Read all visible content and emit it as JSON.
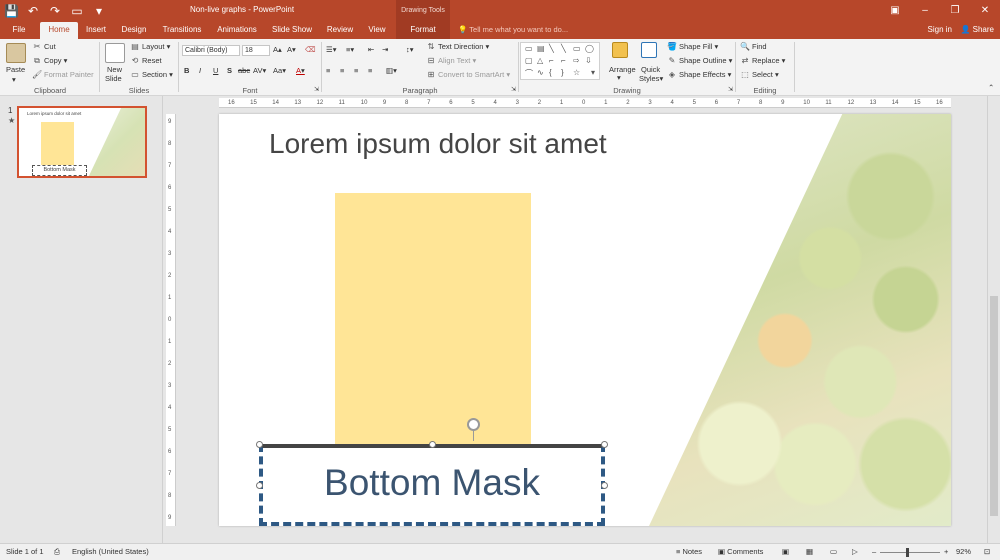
{
  "window": {
    "title": "Non-live graphs - PowerPoint",
    "context_group": "Drawing Tools",
    "quick_access": [
      "save-icon",
      "undo-icon",
      "redo-icon",
      "start-icon",
      "customize-icon"
    ]
  },
  "tabs": [
    {
      "label": "File"
    },
    {
      "label": "Home"
    },
    {
      "label": "Insert"
    },
    {
      "label": "Design"
    },
    {
      "label": "Transitions"
    },
    {
      "label": "Animations"
    },
    {
      "label": "Slide Show"
    },
    {
      "label": "Review"
    },
    {
      "label": "View"
    },
    {
      "label": "Format"
    }
  ],
  "tell_me": "Tell me what you want to do...",
  "account": {
    "sign_in": "Sign in",
    "share": "Share"
  },
  "ribbon": {
    "clipboard": {
      "label": "Clipboard",
      "paste": "Paste",
      "cut": "Cut",
      "copy": "Copy",
      "format_painter": "Format Painter"
    },
    "slides": {
      "label": "Slides",
      "new_slide": "New",
      "new_slide2": "Slide",
      "layout": "Layout",
      "reset": "Reset",
      "section": "Section"
    },
    "font": {
      "label": "Font",
      "font_name": "Calibri (Body)",
      "font_size": "18",
      "bold": "B",
      "italic": "I",
      "underline": "U",
      "strike": "S",
      "shadow": "abc",
      "spacing": "AV",
      "case": "Aa",
      "color": "A"
    },
    "paragraph": {
      "label": "Paragraph",
      "text_direction": "Text Direction",
      "align_text": "Align Text",
      "convert_smartart": "Convert to SmartArt"
    },
    "drawing": {
      "label": "Drawing",
      "arrange": "Arrange",
      "quick_styles": "Quick",
      "quick_styles2": "Styles",
      "shape_fill": "Shape Fill",
      "shape_outline": "Shape Outline",
      "shape_effects": "Shape Effects"
    },
    "editing": {
      "label": "Editing",
      "find": "Find",
      "replace": "Replace",
      "select": "Select"
    }
  },
  "thumbnail": {
    "number": "1",
    "title": "Lorem ipsum dolor sit amet",
    "box_text": "Bottom Mask"
  },
  "ruler": {
    "h_ticks": [
      "16",
      "15",
      "14",
      "13",
      "12",
      "11",
      "10",
      "9",
      "8",
      "7",
      "6",
      "5",
      "4",
      "3",
      "2",
      "1",
      "0",
      "1",
      "2",
      "3",
      "4",
      "5",
      "6",
      "7",
      "8",
      "9",
      "10",
      "11",
      "12",
      "13",
      "14",
      "15",
      "16"
    ],
    "v_ticks": [
      "9",
      "8",
      "7",
      "6",
      "5",
      "4",
      "3",
      "2",
      "1",
      "0",
      "1",
      "2",
      "3",
      "4",
      "5",
      "6",
      "7",
      "8",
      "9"
    ]
  },
  "slide": {
    "title": "Lorem ipsum dolor sit amet",
    "mask_text": "Bottom Mask",
    "colors": {
      "yellow": "#ffe596",
      "mask_border": "#2e5984",
      "mask_text": "#3b5470",
      "accent": "#b7472a"
    }
  },
  "status": {
    "slide_info": "Slide 1 of 1",
    "language": "English (United States)",
    "notes": "Notes",
    "comments": "Comments",
    "zoom": "92%"
  }
}
